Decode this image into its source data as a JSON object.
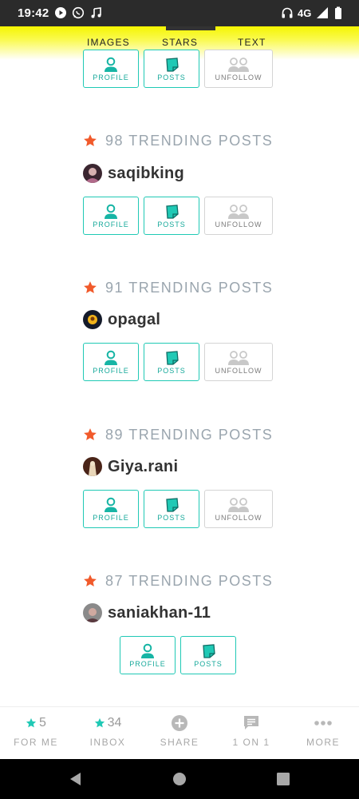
{
  "status_bar": {
    "time": "19:42",
    "network": "4G",
    "icons": [
      "play-icon",
      "whatsapp-icon",
      "music-note-icon",
      "headphones-icon",
      "signal-icon",
      "battery-icon"
    ]
  },
  "top_tabs": [
    "IMAGES",
    "STARS",
    "TEXT"
  ],
  "colors": {
    "accent": "#20c9b5",
    "star": "#f15a2b",
    "trend_text": "#9aa5ae",
    "header_yellow": "#f5f500"
  },
  "cards": [
    {
      "trend_count_text": "98 TRENDING POSTS",
      "username": "saqibking",
      "buttons": {
        "profile": "PROFILE",
        "posts": "POSTS",
        "unfollow": "UNFOLLOW"
      }
    },
    {
      "trend_count_text": "91 TRENDING POSTS",
      "username": "opagal",
      "buttons": {
        "profile": "PROFILE",
        "posts": "POSTS",
        "unfollow": "UNFOLLOW"
      }
    },
    {
      "trend_count_text": "89 TRENDING POSTS",
      "username": "Giya.rani",
      "buttons": {
        "profile": "PROFILE",
        "posts": "POSTS",
        "unfollow": "UNFOLLOW"
      }
    },
    {
      "trend_count_text": "87 TRENDING POSTS",
      "username": "saniakhan-11",
      "buttons": {
        "profile": "PROFILE",
        "posts": "POSTS"
      }
    }
  ],
  "top_partial_card": {
    "buttons": {
      "profile": "PROFILE",
      "posts": "POSTS",
      "unfollow": "UNFOLLOW"
    }
  },
  "bottom_nav": [
    {
      "count": "5",
      "label": "FOR ME",
      "icon": "star-icon"
    },
    {
      "count": "34",
      "label": "INBOX",
      "icon": "star-icon"
    },
    {
      "count": "",
      "label": "SHARE",
      "icon": "plus-circle-icon"
    },
    {
      "count": "",
      "label": "1 ON 1",
      "icon": "chat-icon"
    },
    {
      "count": "",
      "label": "MORE",
      "icon": "more-dots-icon"
    }
  ]
}
